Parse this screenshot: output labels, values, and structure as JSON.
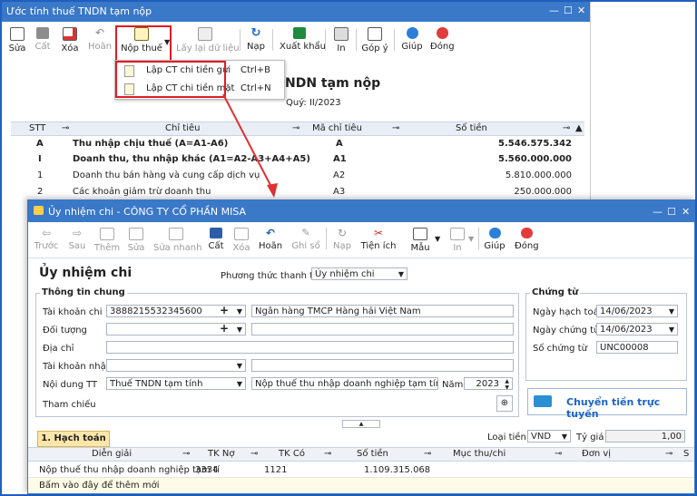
{
  "back_window": {
    "title": "Ước tính thuế TNDN tạm nộp",
    "toolbar": [
      {
        "label": "Sửa",
        "icon": "edit-icon"
      },
      {
        "label": "Cất",
        "icon": "save-icon"
      },
      {
        "label": "Xóa",
        "icon": "delete-icon"
      },
      {
        "label": "Hoãn",
        "icon": "undo-icon"
      },
      {
        "label": "Nộp thuế",
        "icon": "pay-tax-icon"
      },
      {
        "label": "Lấy lại dữ liệu",
        "icon": "reload-data-icon"
      },
      {
        "label": "Nạp",
        "icon": "refresh-icon"
      },
      {
        "label": "Xuất khẩu",
        "icon": "excel-icon"
      },
      {
        "label": "In",
        "icon": "print-icon"
      },
      {
        "label": "Góp ý",
        "icon": "feedback-icon"
      },
      {
        "label": "Giúp",
        "icon": "help-icon"
      },
      {
        "label": "Đóng",
        "icon": "close-icon"
      }
    ],
    "menu": [
      {
        "label": "Lập CT chi tiền gửi",
        "shortcut": "Ctrl+B"
      },
      {
        "label": "Lập CT chi tiền mặt",
        "shortcut": "Ctrl+N"
      }
    ],
    "report_title": "NDN tạm nộp",
    "quarter": "Quý: II/2023",
    "columns": {
      "stt": "STT",
      "chi_tieu": "Chỉ tiêu",
      "ma": "Mã chỉ tiêu",
      "so_tien": "Số tiền"
    },
    "rows": [
      {
        "stt": "A",
        "chi_tieu": "Thu nhập chịu thuế (A=A1-A6)",
        "ma": "A",
        "so_tien": "5.546.575.342"
      },
      {
        "stt": "I",
        "chi_tieu": "Doanh thu, thu nhập khác (A1=A2-A3+A4+A5)",
        "ma": "A1",
        "so_tien": "5.560.000.000"
      },
      {
        "stt": "1",
        "chi_tieu": "Doanh thu bán hàng và cung cấp dịch vụ",
        "ma": "A2",
        "so_tien": "5.810.000.000"
      },
      {
        "stt": "2",
        "chi_tieu": "Các khoản giảm trừ doanh thu",
        "ma": "A3",
        "so_tien": "250.000.000"
      }
    ]
  },
  "front_window": {
    "title": "Ủy nhiệm chi - CÔNG TY CỔ PHẦN MISA",
    "toolbar": [
      {
        "label": "Trước",
        "icon": "prev-icon"
      },
      {
        "label": "Sau",
        "icon": "next-icon"
      },
      {
        "label": "Thêm",
        "icon": "add-icon"
      },
      {
        "label": "Sửa",
        "icon": "edit-icon"
      },
      {
        "label": "Sửa nhanh",
        "icon": "quick-edit-icon"
      },
      {
        "label": "Cất",
        "icon": "save-icon"
      },
      {
        "label": "Xóa",
        "icon": "delete-icon"
      },
      {
        "label": "Hoãn",
        "icon": "undo-icon"
      },
      {
        "label": "Ghi sổ",
        "icon": "post-icon"
      },
      {
        "label": "Nạp",
        "icon": "refresh-icon"
      },
      {
        "label": "Tiện ích",
        "icon": "utility-icon"
      },
      {
        "label": "Mẫu",
        "icon": "template-icon"
      },
      {
        "label": "In",
        "icon": "print-icon"
      },
      {
        "label": "Giúp",
        "icon": "help-icon"
      },
      {
        "label": "Đóng",
        "icon": "close-icon"
      }
    ],
    "heading": "Ủy nhiệm chi",
    "payment_method_label": "Phương thức thanh toán",
    "payment_method_value": "Ủy nhiệm chi",
    "general_section": "Thông tin chung",
    "fields": {
      "tai_khoan_chi_label": "Tài khoản chi",
      "tai_khoan_chi_value": "3888215532345600",
      "bank_name": "Ngân hàng TMCP Hàng hải Việt Nam",
      "doi_tuong_label": "Đối tượng",
      "dia_chi_label": "Địa chỉ",
      "tai_khoan_nhan_label": "Tài khoản nhận",
      "noi_dung_label": "Nội dung TT",
      "noi_dung_value": "Thuế TNDN tạm tính",
      "noi_dung_desc": "Nộp thuế thu nhập doanh nghiệp tạm tính quý II/",
      "nam_label": "Năm",
      "nam_value": "2023",
      "tham_chieu_label": "Tham chiếu"
    },
    "voucher_section": "Chứng từ",
    "voucher": {
      "ngay_hach_toan_label": "Ngày hạch toán",
      "ngay_hach_toan_value": "14/06/2023",
      "ngay_chung_tu_label": "Ngày chứng từ",
      "ngay_chung_tu_value": "14/06/2023",
      "so_chung_tu_label": "Số chứng từ",
      "so_chung_tu_value": "UNC00008"
    },
    "transfer_button": "Chuyển tiền trực tuyến",
    "currency_label": "Loại tiền",
    "currency_value": "VND",
    "rate_label": "Tỷ giá",
    "rate_value": "1,00",
    "tab": "1. Hạch toán",
    "columns": {
      "dien_giai": "Diễn giải",
      "tk_no": "TK Nợ",
      "tk_co": "TK Có",
      "so_tien": "Số tiền",
      "muc_thu_chi": "Mục thu/chi",
      "don_vi": "Đơn vị",
      "s": "S"
    },
    "rows": [
      {
        "dien_giai": "Nộp thuế thu nhập doanh nghiệp tạm tí",
        "tk_no": "3334",
        "tk_co": "1121",
        "so_tien": "1.109.315.068"
      }
    ],
    "add_row_hint": "Bấm vào đây để thêm mới"
  }
}
